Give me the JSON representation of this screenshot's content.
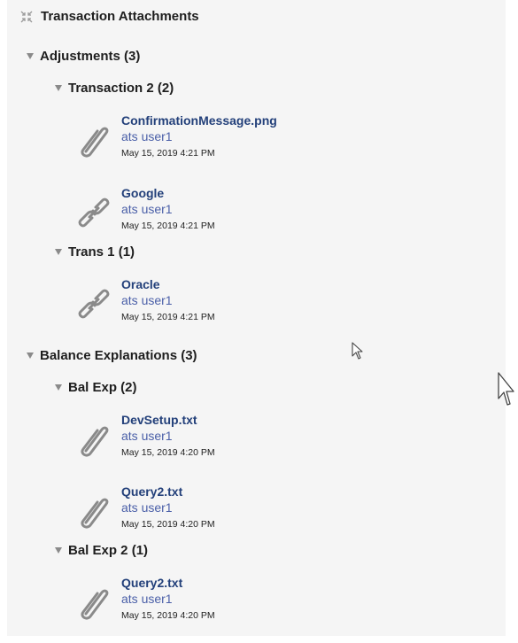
{
  "panel": {
    "title": "Transaction Attachments",
    "collapse_icon": "collapse-arrows-icon"
  },
  "groups": [
    {
      "label": "Adjustments (3)",
      "subgroups": [
        {
          "label": "Transaction 2 (2)",
          "items": [
            {
              "icon": "paperclip-icon",
              "name": "ConfirmationMessage.png",
              "user": "ats user1",
              "date": "May 15, 2019 4:21 PM"
            },
            {
              "icon": "link-icon",
              "name": "Google",
              "user": "ats user1",
              "date": "May 15, 2019 4:21 PM"
            }
          ]
        },
        {
          "label": "Trans 1 (1)",
          "items": [
            {
              "icon": "link-icon",
              "name": "Oracle",
              "user": "ats user1",
              "date": "May 15, 2019 4:21 PM"
            }
          ]
        }
      ]
    },
    {
      "label": "Balance Explanations (3)",
      "subgroups": [
        {
          "label": "Bal Exp (2)",
          "items": [
            {
              "icon": "paperclip-icon",
              "name": "DevSetup.txt",
              "user": "ats user1",
              "date": "May 15, 2019 4:20 PM"
            },
            {
              "icon": "paperclip-icon",
              "name": "Query2.txt",
              "user": "ats user1",
              "date": "May 15, 2019 4:20 PM"
            }
          ]
        },
        {
          "label": "Bal Exp 2 (1)",
          "items": [
            {
              "icon": "paperclip-icon",
              "name": "Query2.txt",
              "user": "ats user1",
              "date": "May 15, 2019 4:20 PM"
            }
          ]
        }
      ]
    }
  ]
}
